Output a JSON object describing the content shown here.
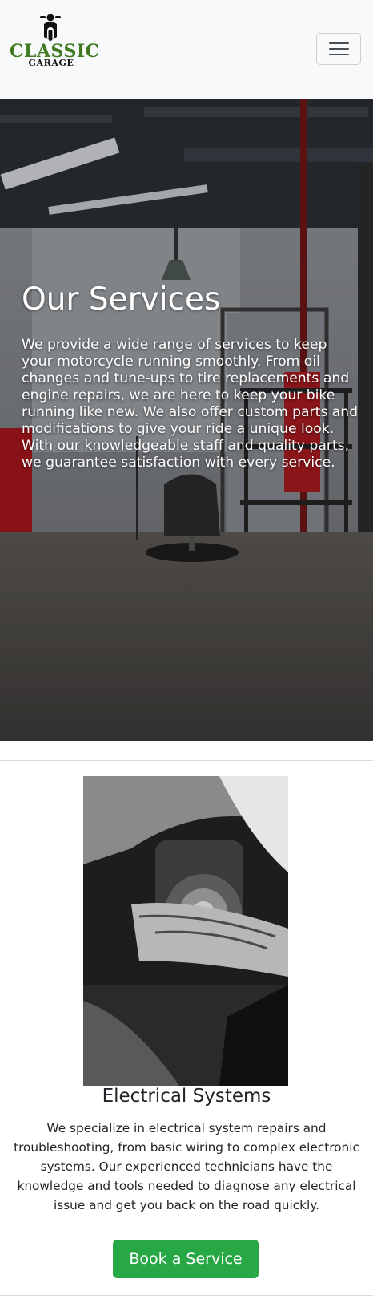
{
  "navbar": {
    "logo": {
      "line1": "CLASSIC",
      "line2": "GARAGE",
      "brand_color": "#3f7a1f"
    },
    "menu_toggle_icon": "hamburger-icon"
  },
  "hero": {
    "title": "Our Services",
    "description": "We provide a wide range of services to keep your motorcycle running smoothly. From oil changes and tune-ups to tire replacements and engine repairs, we are here to keep your bike running like new. We also offer custom parts and modifications to give your ride a unique look. With our knowledgeable staff and quality parts, we guarantee satisfaction with every service."
  },
  "service": {
    "title": "Electrical Systems",
    "description": "We specialize in electrical system repairs and troubleshooting, from basic wiring to complex electronic systems. Our experienced technicians have the knowledge and tools needed to diagnose any electrical issue and get you back on the road quickly.",
    "button_label": "Book a Service",
    "button_color": "#28a745"
  }
}
